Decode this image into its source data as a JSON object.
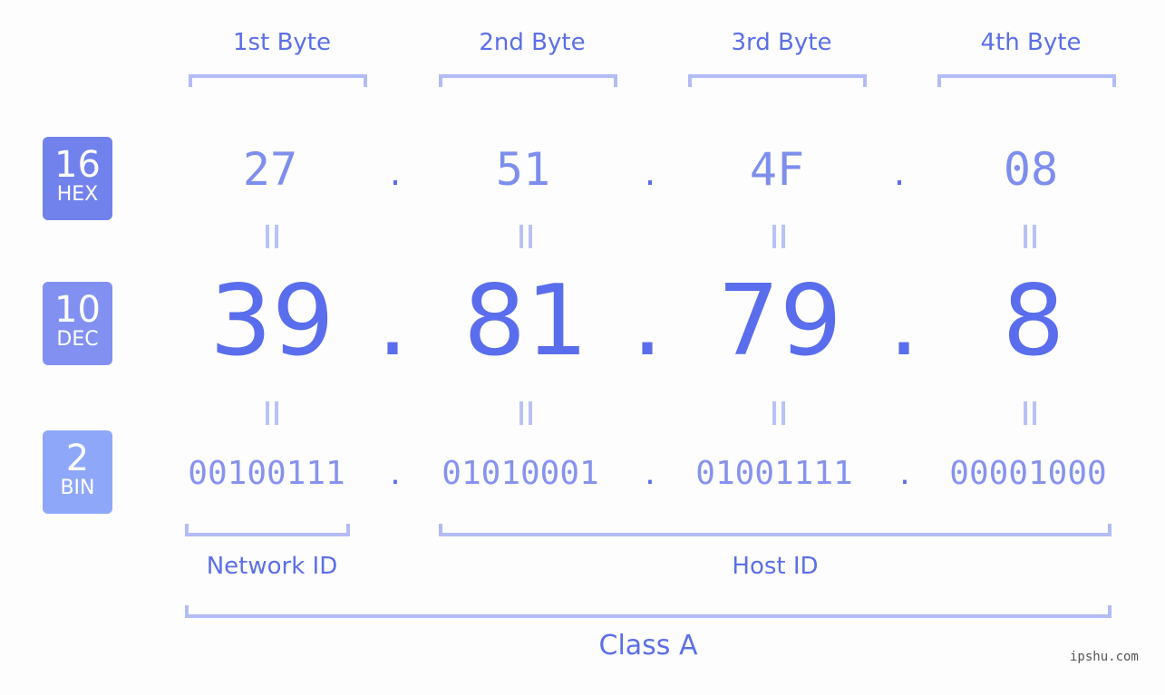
{
  "bytes": [
    {
      "label": "1st Byte",
      "hex": "27",
      "dec": "39",
      "bin": "00100111"
    },
    {
      "label": "2nd Byte",
      "hex": "51",
      "dec": "81",
      "bin": "01010001"
    },
    {
      "label": "3rd Byte",
      "hex": "4F",
      "dec": "79",
      "bin": "01001111"
    },
    {
      "label": "4th Byte",
      "hex": "08",
      "dec": "8",
      "bin": "00001000"
    }
  ],
  "separator": ".",
  "badges": {
    "hex": {
      "base": "16",
      "label": "HEX",
      "color": "#7282ec"
    },
    "dec": {
      "base": "10",
      "label": "DEC",
      "color": "#8291f1"
    },
    "bin": {
      "base": "2",
      "label": "BIN",
      "color": "#8ea7f8"
    }
  },
  "ids": {
    "network": "Network ID",
    "host": "Host ID"
  },
  "class_label": "Class A",
  "watermark": "ipshu.com",
  "colors": {
    "accent": "#5a6ded",
    "bracket": "#b3bcf6"
  }
}
